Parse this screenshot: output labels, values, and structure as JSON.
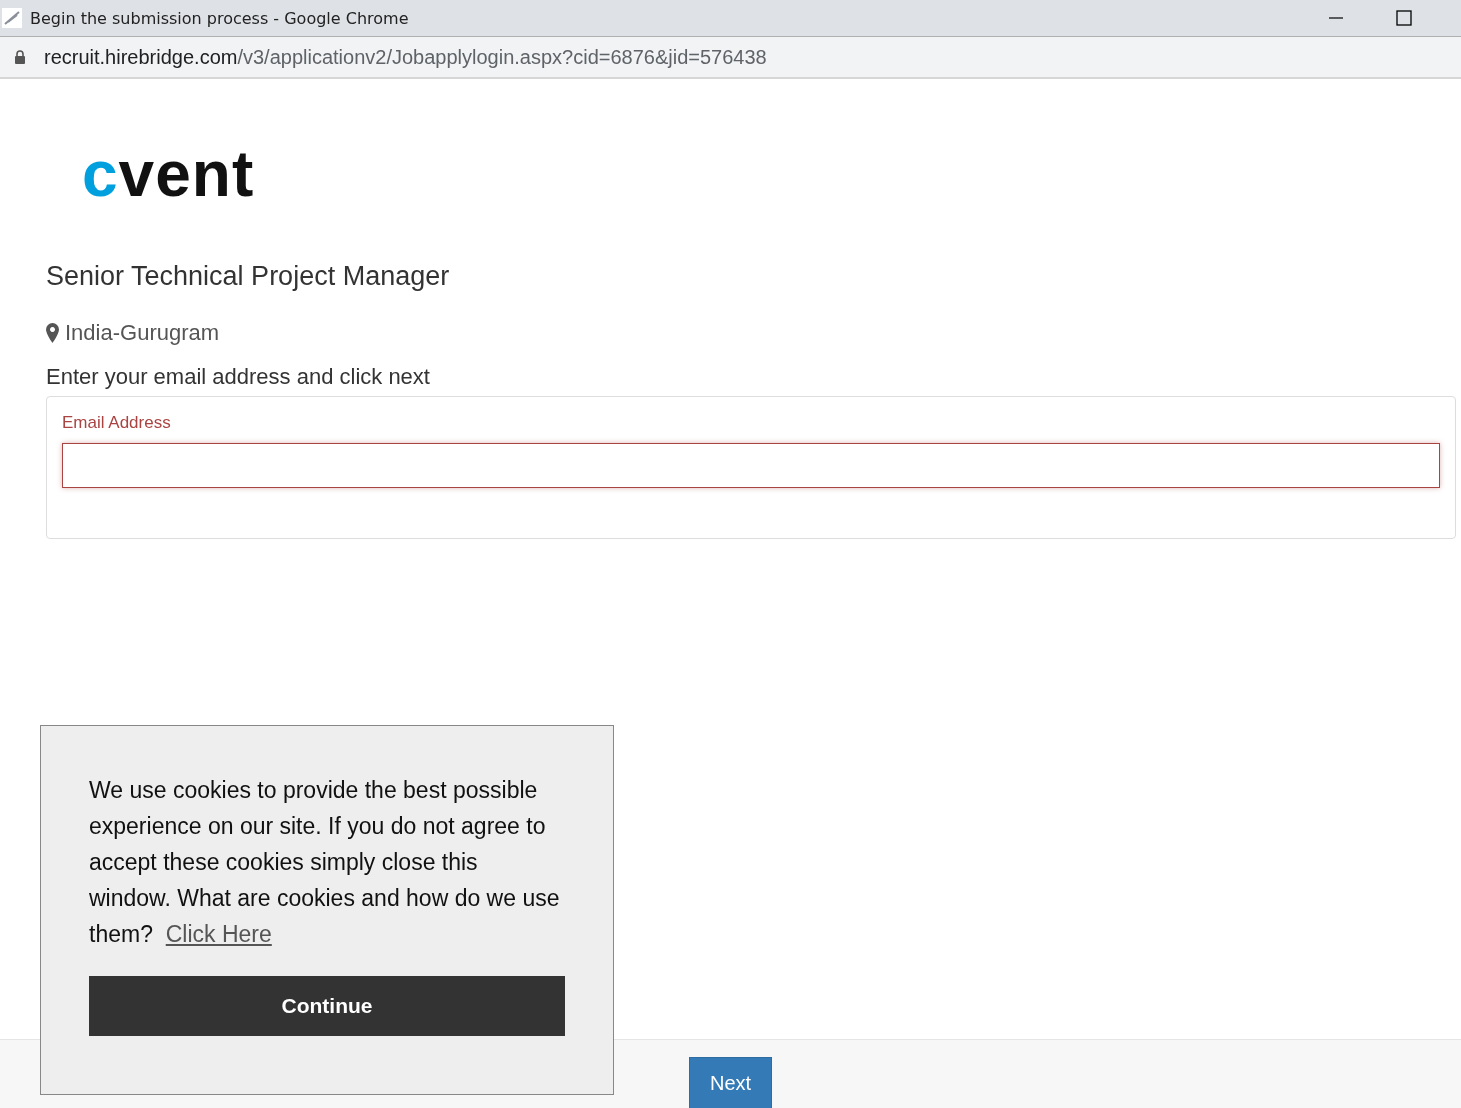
{
  "window": {
    "title": "Begin the submission process - Google Chrome"
  },
  "address_bar": {
    "host": "recruit.hirebridge.com",
    "path": "/v3/applicationv2/Jobapplylogin.aspx?cid=6876&jid=576438"
  },
  "logo": "cvent",
  "job_title": "Senior Technical Project Manager",
  "location": "India-Gurugram",
  "instruction": "Enter your email address and click next",
  "email_field": {
    "label": "Email Address",
    "invalid": true
  },
  "cookie_banner": {
    "text": "We use cookies to provide the best possible experience on our site. If you do not agree to accept these cookies simply close this window. What are cookies and how do we use them?",
    "link": "Click Here",
    "button": "Continue"
  },
  "footer": {
    "button": "Next"
  }
}
